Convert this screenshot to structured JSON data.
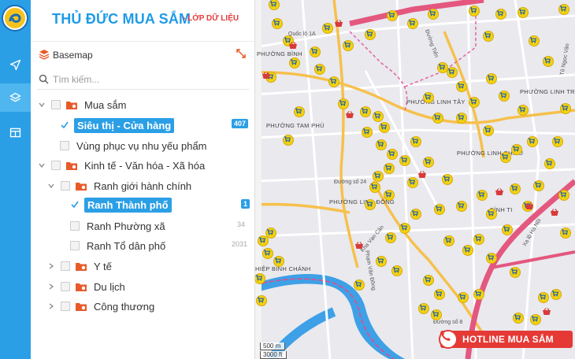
{
  "header": {
    "title": "THỦ ĐỨC MUA SẮM",
    "subtitle": "› LỚP DỮ LIỆU"
  },
  "rail": {
    "items": [
      {
        "icon": "logo-icon"
      },
      {
        "icon": "navigate-icon"
      },
      {
        "icon": "layers-icon"
      },
      {
        "icon": "dashboard-icon"
      }
    ]
  },
  "basemap": {
    "label": "Basemap"
  },
  "search": {
    "placeholder": "Tìm kiếm..."
  },
  "tree": [
    {
      "label": "Mua sắm",
      "count": ""
    },
    {
      "label": "Siêu thị - Cửa hàng",
      "count": "407"
    },
    {
      "label": "Vùng phục vụ nhu yếu phẩm",
      "count": ""
    },
    {
      "label": "Kinh tế - Văn hóa - Xã hóa",
      "count": ""
    },
    {
      "label": "Ranh giới hành chính",
      "count": ""
    },
    {
      "label": "Ranh Thành phố",
      "count": "1"
    },
    {
      "label": "Ranh Phường xã",
      "count": "34"
    },
    {
      "label": "Ranh Tổ dân phố",
      "count": "2031"
    },
    {
      "label": "Y tế",
      "count": ""
    },
    {
      "label": "Du lịch",
      "count": ""
    },
    {
      "label": "Công thương",
      "count": ""
    }
  ],
  "map": {
    "labels": {
      "quoc_lo_1a": "Quốc lộ 1A",
      "binh_chieu": "PHƯỜNG BÌNH",
      "linh_tay": "PHƯỜNG LINH TÂY",
      "linh_trung": "PHƯỜNG LINH TRUNG",
      "tam_phu": "PHƯỜNG TAM PHÚ",
      "linh_chieu": "PHƯỜNG LINH CHIỂU",
      "linh_dong": "PHƯỜNG LINH ĐÔNG",
      "binh_tho": "BÌNH TI",
      "hiep_binh_chanh": "HIỆP BÌNH CHÁNH",
      "duong_so_24": "Đường số 24",
      "duong_so_8": "Đường số 8",
      "kha_van_can": "Kha Vạn Cân",
      "dong_tien": "Đường Tiến",
      "xa_lo_ha_noi": "Xa lộ Hà Nội",
      "to_ngoc_van": "Tô Ngọc Vân",
      "pham_van_dong": "Phạm Văn Đồng"
    },
    "scale": {
      "metric": "500 m",
      "imperial": "3000 ft"
    }
  },
  "hotline": {
    "label": "HOTLINE MUA SẮM"
  },
  "colors": {
    "accent": "#2b9fe6",
    "title": "#1f9be8",
    "hotline": "#e53935",
    "poi": "#f4d20f",
    "river": "#3ea0e6"
  }
}
